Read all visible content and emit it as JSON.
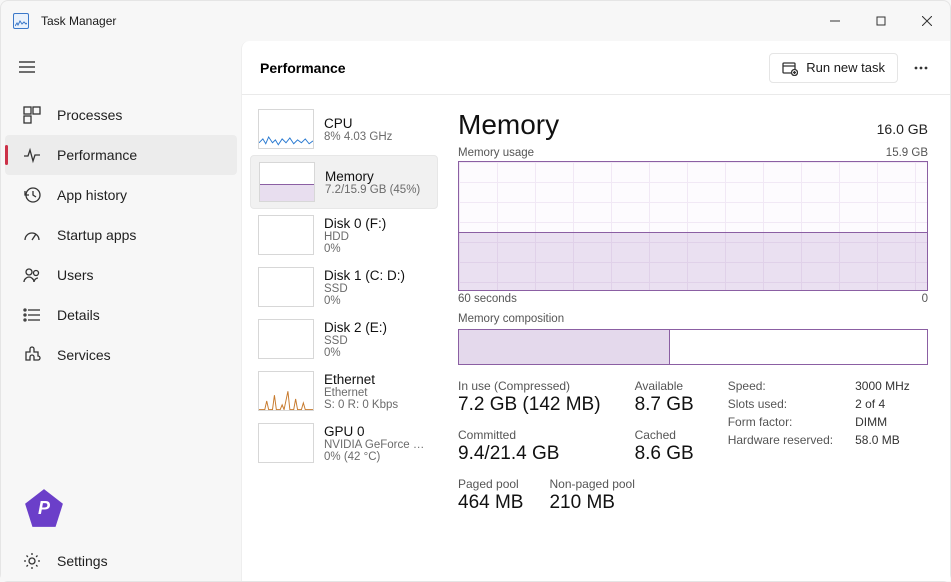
{
  "window": {
    "title": "Task Manager"
  },
  "sidebar": {
    "items": [
      {
        "label": "Processes"
      },
      {
        "label": "Performance"
      },
      {
        "label": "App history"
      },
      {
        "label": "Startup apps"
      },
      {
        "label": "Users"
      },
      {
        "label": "Details"
      },
      {
        "label": "Services"
      }
    ],
    "settings_label": "Settings"
  },
  "header": {
    "title": "Performance",
    "run_task_label": "Run new task"
  },
  "perf_list": [
    {
      "name": "CPU",
      "sub": "8%  4.03 GHz"
    },
    {
      "name": "Memory",
      "sub": "7.2/15.9 GB (45%)"
    },
    {
      "name": "Disk 0 (F:)",
      "sub": "HDD",
      "sub2": "0%"
    },
    {
      "name": "Disk 1 (C: D:)",
      "sub": "SSD",
      "sub2": "0%"
    },
    {
      "name": "Disk 2 (E:)",
      "sub": "SSD",
      "sub2": "0%"
    },
    {
      "name": "Ethernet",
      "sub": "Ethernet",
      "sub2": "S: 0  R: 0 Kbps"
    },
    {
      "name": "GPU 0",
      "sub": "NVIDIA GeForce R...",
      "sub2": "0%  (42 °C)"
    }
  ],
  "detail": {
    "title": "Memory",
    "total": "16.0 GB",
    "usage_label": "Memory usage",
    "usage_max": "15.9 GB",
    "axis_left": "60 seconds",
    "axis_right": "0",
    "composition_label": "Memory composition",
    "in_use_label": "In use (Compressed)",
    "in_use_value": "7.2 GB (142 MB)",
    "available_label": "Available",
    "available_value": "8.7 GB",
    "committed_label": "Committed",
    "committed_value": "9.4/21.4 GB",
    "cached_label": "Cached",
    "cached_value": "8.6 GB",
    "paged_label": "Paged pool",
    "paged_value": "464 MB",
    "nonpaged_label": "Non-paged pool",
    "nonpaged_value": "210 MB",
    "props": {
      "speed_k": "Speed:",
      "speed_v": "3000 MHz",
      "slots_k": "Slots used:",
      "slots_v": "2 of 4",
      "form_k": "Form factor:",
      "form_v": "DIMM",
      "hwres_k": "Hardware reserved:",
      "hwres_v": "58.0 MB"
    }
  },
  "chart_data": {
    "type": "area",
    "title": "Memory usage",
    "xlabel": "seconds ago",
    "ylabel": "GB",
    "x_range_seconds": [
      60,
      0
    ],
    "ylim": [
      0,
      15.9
    ],
    "series": [
      {
        "name": "Memory usage (GB)",
        "values": [
          7.2,
          7.2,
          7.2,
          7.2,
          7.2,
          7.2,
          7.2,
          7.2,
          7.2,
          7.2,
          7.2,
          7.2,
          7.2,
          7.2,
          7.2,
          7.2,
          7.2,
          7.2,
          7.2,
          7.2,
          7.2,
          7.2,
          7.2,
          7.2,
          7.2,
          7.2,
          7.2,
          7.2,
          7.2,
          7.2,
          7.2,
          7.2,
          7.2,
          7.2,
          7.2,
          7.2,
          7.2,
          7.2,
          7.2,
          7.2,
          7.2,
          7.2,
          7.2,
          7.2,
          7.2,
          7.2,
          7.2,
          7.2,
          7.2,
          7.2,
          7.2,
          7.2,
          7.2,
          7.2,
          7.2,
          7.2,
          7.2,
          7.2,
          7.2,
          7.2
        ]
      }
    ],
    "composition": {
      "in_use_gb": 7.2,
      "total_gb": 15.9
    }
  }
}
